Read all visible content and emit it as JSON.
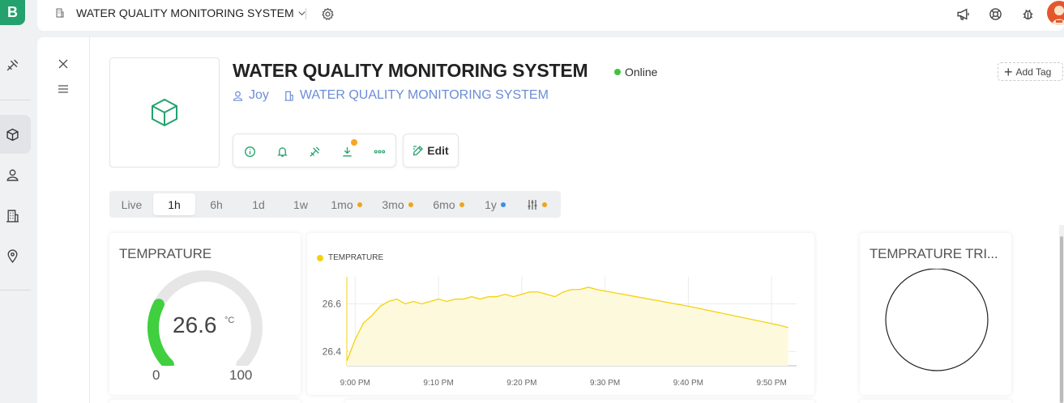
{
  "app": {
    "logo_letter": "B"
  },
  "rail": {
    "items": [
      "tools-icon",
      "box-icon",
      "users-icon",
      "building-icon",
      "location-icon"
    ]
  },
  "topbar": {
    "org_name": "WATER QUALITY MONITORING SYSTEM"
  },
  "device": {
    "title": "WATER QUALITY MONITORING SYSTEM",
    "status": "Online",
    "owner": "Joy",
    "organization": "WATER QUALITY MONITORING SYSTEM",
    "add_tag_label": "Add Tag",
    "edit_label": "Edit",
    "status_color": "#3fc33f"
  },
  "time_range": {
    "options": [
      {
        "label": "Live",
        "selected": false,
        "dot": null
      },
      {
        "label": "1h",
        "selected": true,
        "dot": null
      },
      {
        "label": "6h",
        "selected": false,
        "dot": null
      },
      {
        "label": "1d",
        "selected": false,
        "dot": null
      },
      {
        "label": "1w",
        "selected": false,
        "dot": null
      },
      {
        "label": "1mo",
        "selected": false,
        "dot": "#f0a31a"
      },
      {
        "label": "3mo",
        "selected": false,
        "dot": "#f0a31a"
      },
      {
        "label": "6mo",
        "selected": false,
        "dot": "#f0a31a"
      },
      {
        "label": "1y",
        "selected": false,
        "dot": "#3b8cf0"
      }
    ]
  },
  "gauge": {
    "title": "TEMPRATURE",
    "value": "26.6",
    "unit": "°C",
    "min": "0",
    "max": "100",
    "fill_fraction": 0.266,
    "color": "#3fcf3f"
  },
  "line_widget": {
    "legend": "TEMPRATURE",
    "color": "#f3d20f"
  },
  "trend_widget": {
    "title": "TEMPRATURE TRI..."
  },
  "chart_data": {
    "type": "area",
    "series": [
      {
        "name": "TEMPRATURE",
        "x": [
          "8:59 PM",
          "9:00 PM",
          "9:01 PM",
          "9:02 PM",
          "9:03 PM",
          "9:04 PM",
          "9:05 PM",
          "9:06 PM",
          "9:07 PM",
          "9:08 PM",
          "9:09 PM",
          "9:10 PM",
          "9:11 PM",
          "9:12 PM",
          "9:13 PM",
          "9:14 PM",
          "9:15 PM",
          "9:16 PM",
          "9:17 PM",
          "9:18 PM",
          "9:19 PM",
          "9:20 PM",
          "9:21 PM",
          "9:22 PM",
          "9:23 PM",
          "9:24 PM",
          "9:25 PM",
          "9:26 PM",
          "9:27 PM",
          "9:28 PM",
          "9:29 PM",
          "9:40 PM",
          "9:51 PM",
          "9:52 PM"
        ],
        "values": [
          26.36,
          26.45,
          26.52,
          26.55,
          26.59,
          26.61,
          26.62,
          26.6,
          26.61,
          26.6,
          26.61,
          26.62,
          26.61,
          26.62,
          26.62,
          26.63,
          26.62,
          26.63,
          26.63,
          26.64,
          26.63,
          26.64,
          26.65,
          26.65,
          26.64,
          26.63,
          26.65,
          26.66,
          26.66,
          26.67,
          26.66,
          26.59,
          26.51,
          26.5
        ]
      }
    ],
    "y_ticks": [
      "26.4",
      "26.6"
    ],
    "x_ticks": [
      "9:00 PM",
      "9:10 PM",
      "9:20 PM",
      "9:30 PM",
      "9:40 PM",
      "9:50 PM"
    ],
    "ylim": [
      26.34,
      26.7
    ],
    "grid": true
  }
}
